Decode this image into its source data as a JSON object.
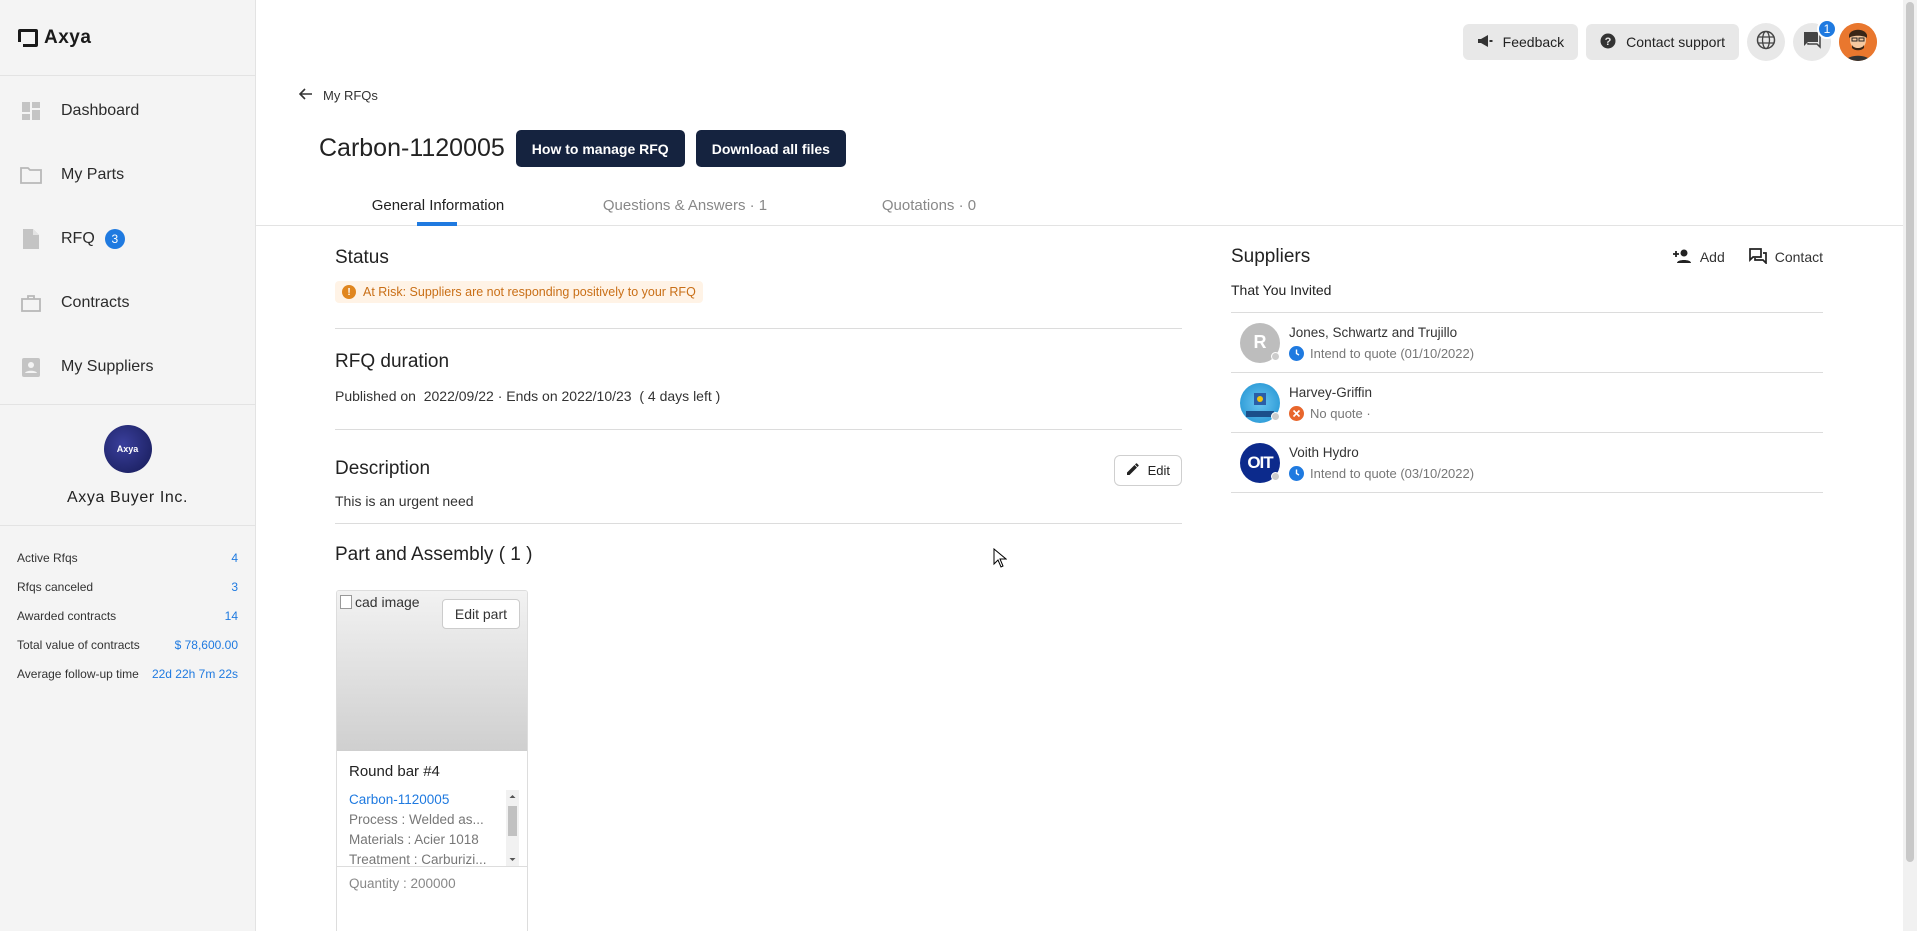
{
  "app": {
    "logo_text": "Axya"
  },
  "sidebar": {
    "items": [
      {
        "label": "Dashboard",
        "icon": "dashboard-icon"
      },
      {
        "label": "My Parts",
        "icon": "folder-icon"
      },
      {
        "label": "RFQ",
        "icon": "file-icon",
        "badge": "3"
      },
      {
        "label": "Contracts",
        "icon": "briefcase-icon"
      },
      {
        "label": "My Suppliers",
        "icon": "contacts-icon"
      }
    ],
    "company": {
      "avatar_text": "Axya",
      "name": "Axya Buyer Inc."
    },
    "stats": [
      {
        "label": "Active Rfqs",
        "value": "4"
      },
      {
        "label": "Rfqs canceled",
        "value": "3"
      },
      {
        "label": "Awarded contracts",
        "value": "14"
      },
      {
        "label": "Total value of contracts",
        "value": "$ 78,600.00"
      },
      {
        "label": "Average follow-up time",
        "value": "22d 22h 7m 22s"
      }
    ]
  },
  "topbar": {
    "feedback": "Feedback",
    "contact_support": "Contact support",
    "notification_count": "1"
  },
  "main": {
    "back_label": "My RFQs",
    "title": "Carbon-1120005",
    "how_to_btn": "How to manage RFQ",
    "download_btn": "Download all files",
    "tabs": [
      {
        "label": "General Information"
      },
      {
        "label": "Questions & Answers · 1"
      },
      {
        "label": "Quotations · 0"
      }
    ],
    "status": {
      "title": "Status",
      "risk_text": "At Risk: Suppliers are not responding positively to your RFQ"
    },
    "duration": {
      "title": "RFQ duration",
      "published_label": "Published on",
      "published": "2022/09/22",
      "ends": "· Ends on 2022/10/23",
      "left": "( 4 days left )"
    },
    "description": {
      "title": "Description",
      "edit": "Edit",
      "text": "This is an urgent need"
    },
    "parts": {
      "title": "Part and Assembly ( 1 )",
      "card": {
        "image_alt": "cad image",
        "edit_part": "Edit part",
        "name": "Round bar #4",
        "link": "Carbon-1120005",
        "process": "Process : Welded as...",
        "materials": "Materials : Acier 1018",
        "treatment": "Treatment : Carburizi...",
        "quantity": "Quantity : 200000"
      }
    }
  },
  "suppliers": {
    "title": "Suppliers",
    "add": "Add",
    "contact": "Contact",
    "subtitle": "That You Invited",
    "list": [
      {
        "initial": "R",
        "name": "Jones, Schwartz and Trujillo",
        "status": "Intend to quote (01/10/2022)",
        "status_type": "clock"
      },
      {
        "initial": "",
        "name": "Harvey-Griffin",
        "status": "No quote ·",
        "status_type": "cancel"
      },
      {
        "initial": "OIT",
        "name": "Voith Hydro",
        "status": "Intend to quote (03/10/2022)",
        "status_type": "clock"
      }
    ]
  }
}
